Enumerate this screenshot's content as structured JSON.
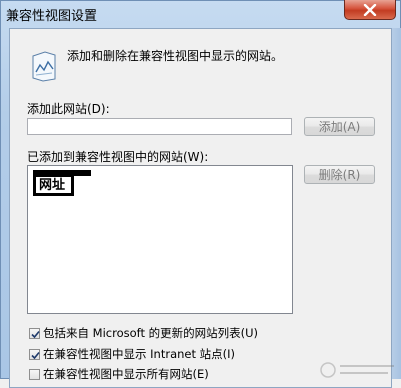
{
  "window": {
    "title": "兼容性视图设置",
    "close_label": "✕"
  },
  "header": {
    "icon": "sites-document-icon",
    "text": "添加和删除在兼容性视图中显示的网站。"
  },
  "add_site": {
    "label": "添加此网站(D):",
    "value": "",
    "button_label": "添加(A)"
  },
  "site_list": {
    "label": "已添加到兼容性视图中的网站(W):",
    "items": [
      "网址"
    ],
    "remove_label": "删除(R)"
  },
  "options": [
    {
      "label": "包括来自 Microsoft 的更新的网站列表(U)",
      "checked": true
    },
    {
      "label": "在兼容性视图中显示 Intranet 站点(I)",
      "checked": true
    },
    {
      "label": "在兼容性视图中显示所有网站(E)",
      "checked": false
    }
  ],
  "colors": {
    "title_bar": "#b3cde8",
    "close_button": "#c23c22",
    "client_bg": "#f0f0f0"
  }
}
